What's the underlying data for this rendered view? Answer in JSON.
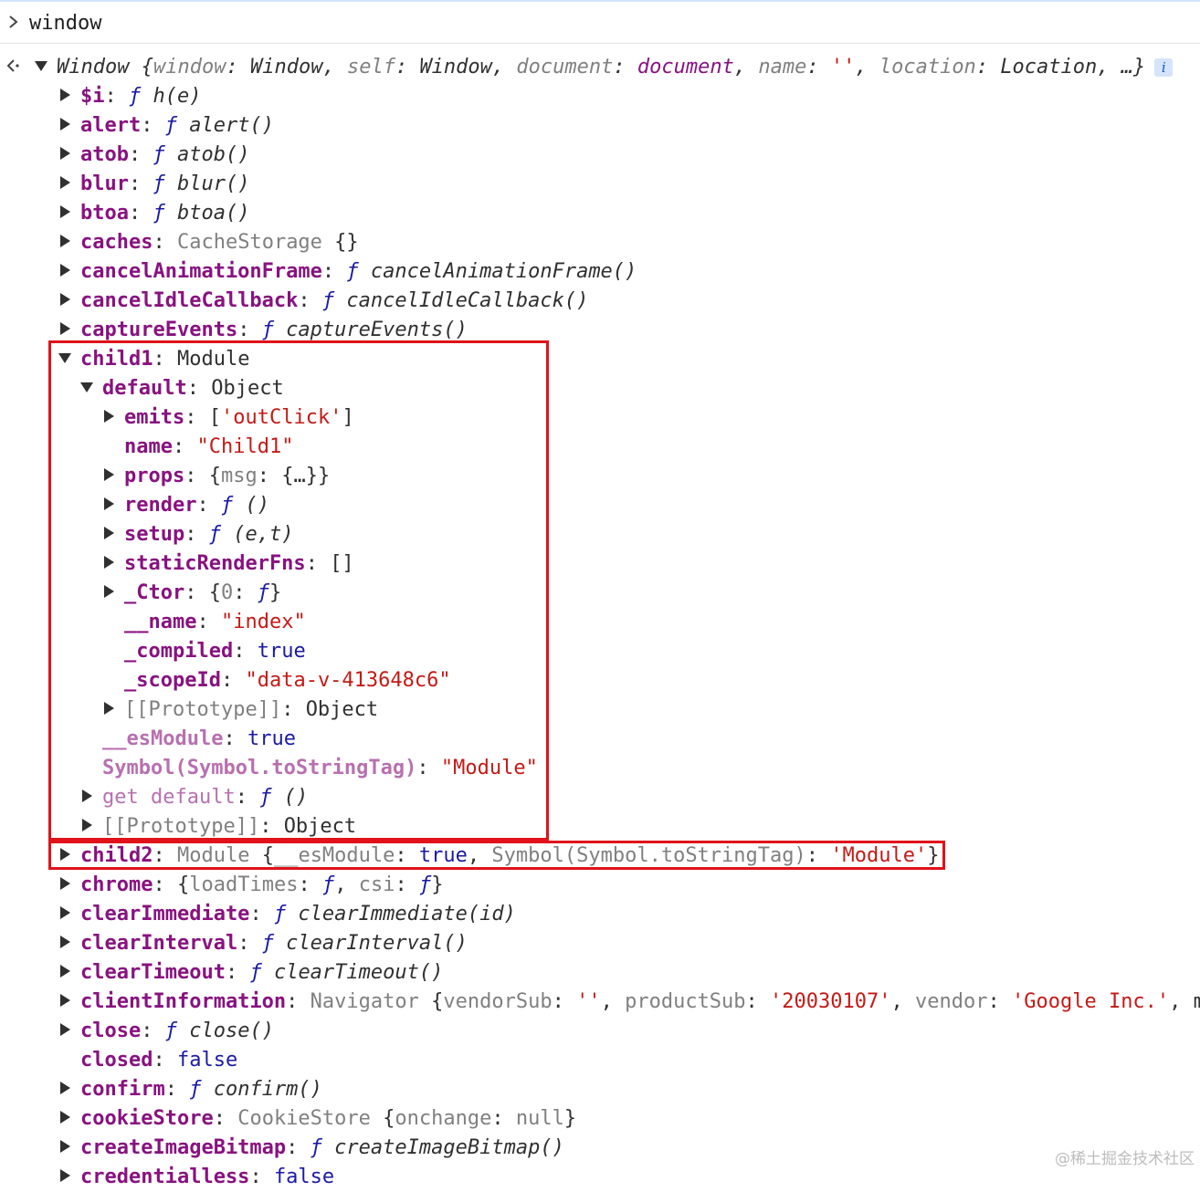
{
  "console": {
    "prompt": "window",
    "window_summary": {
      "name": "Window",
      "props": [
        {
          "key": "window",
          "value": "Window",
          "kind": "cls"
        },
        {
          "key": "self",
          "value": "Window",
          "kind": "cls"
        },
        {
          "key": "document",
          "value": "document",
          "kind": "doc"
        },
        {
          "key": "name",
          "value": "''",
          "kind": "str"
        },
        {
          "key": "location",
          "value": "Location",
          "kind": "cls"
        }
      ],
      "ellipsis": "…}",
      "info_badge": "i"
    },
    "rows": [
      {
        "indent": 0,
        "arrow": "right",
        "key": "$i",
        "tokens": [
          [
            "fkw",
            "ƒ"
          ],
          [
            "fsig",
            " h(e)"
          ]
        ]
      },
      {
        "indent": 0,
        "arrow": "right",
        "key": "alert",
        "tokens": [
          [
            "fkw",
            "ƒ"
          ],
          [
            "fsig",
            " alert()"
          ]
        ]
      },
      {
        "indent": 0,
        "arrow": "right",
        "key": "atob",
        "tokens": [
          [
            "fkw",
            "ƒ"
          ],
          [
            "fsig",
            " atob()"
          ]
        ]
      },
      {
        "indent": 0,
        "arrow": "right",
        "key": "blur",
        "tokens": [
          [
            "fkw",
            "ƒ"
          ],
          [
            "fsig",
            " blur()"
          ]
        ]
      },
      {
        "indent": 0,
        "arrow": "right",
        "key": "btoa",
        "tokens": [
          [
            "fkw",
            "ƒ"
          ],
          [
            "fsig",
            " btoa()"
          ]
        ]
      },
      {
        "indent": 0,
        "arrow": "right",
        "key": "caches",
        "tokens": [
          [
            "gray",
            "CacheStorage"
          ],
          [
            "p",
            " {}"
          ]
        ]
      },
      {
        "indent": 0,
        "arrow": "right",
        "key": "cancelAnimationFrame",
        "tokens": [
          [
            "fkw",
            "ƒ"
          ],
          [
            "fsig",
            " cancelAnimationFrame()"
          ]
        ]
      },
      {
        "indent": 0,
        "arrow": "right",
        "key": "cancelIdleCallback",
        "tokens": [
          [
            "fkw",
            "ƒ"
          ],
          [
            "fsig",
            " cancelIdleCallback()"
          ]
        ]
      },
      {
        "indent": 0,
        "arrow": "right",
        "key": "captureEvents",
        "tokens": [
          [
            "fkw",
            "ƒ"
          ],
          [
            "fsig",
            " captureEvents()"
          ]
        ]
      },
      {
        "indent": 0,
        "arrow": "down",
        "key": "child1",
        "tokens": [
          [
            "cls",
            "Module"
          ]
        ]
      },
      {
        "indent": 1,
        "arrow": "down",
        "key": "default",
        "tokens": [
          [
            "cls",
            "Object"
          ]
        ]
      },
      {
        "indent": 2,
        "arrow": "right",
        "key": "emits",
        "tokens": [
          [
            "p",
            "["
          ],
          [
            "str",
            "'outClick'"
          ],
          [
            "p",
            "]"
          ]
        ]
      },
      {
        "indent": 2,
        "arrow": "none",
        "key": "name",
        "tokens": [
          [
            "str",
            "\"Child1\""
          ]
        ]
      },
      {
        "indent": 2,
        "arrow": "right",
        "key": "props",
        "tokens": [
          [
            "p",
            "{"
          ],
          [
            "gray",
            "msg"
          ],
          [
            "p",
            ": {…}}"
          ]
        ]
      },
      {
        "indent": 2,
        "arrow": "right",
        "key": "render",
        "tokens": [
          [
            "fkw",
            "ƒ"
          ],
          [
            "fsig",
            " ()"
          ]
        ]
      },
      {
        "indent": 2,
        "arrow": "right",
        "key": "setup",
        "tokens": [
          [
            "fkw",
            "ƒ"
          ],
          [
            "fsig",
            " (e,t)"
          ]
        ]
      },
      {
        "indent": 2,
        "arrow": "right",
        "key": "staticRenderFns",
        "tokens": [
          [
            "p",
            "[]"
          ]
        ]
      },
      {
        "indent": 2,
        "arrow": "right",
        "key": "_Ctor",
        "tokens": [
          [
            "p",
            "{"
          ],
          [
            "gray",
            "0"
          ],
          [
            "p",
            ": "
          ],
          [
            "fkw",
            "ƒ"
          ],
          [
            "p",
            "}"
          ]
        ]
      },
      {
        "indent": 2,
        "arrow": "none",
        "key": "__name",
        "tokens": [
          [
            "str",
            "\"index\""
          ]
        ]
      },
      {
        "indent": 2,
        "arrow": "none",
        "key": "_compiled",
        "tokens": [
          [
            "bool",
            "true"
          ]
        ]
      },
      {
        "indent": 2,
        "arrow": "none",
        "key": "_scopeId",
        "tokens": [
          [
            "str",
            "\"data-v-413648c6\""
          ]
        ]
      },
      {
        "indent": 2,
        "arrow": "right",
        "key": "[[Prototype]]",
        "keyStyle": "proto",
        "tokens": [
          [
            "cls",
            "Object"
          ]
        ]
      },
      {
        "indent": 1,
        "arrow": "none",
        "key": "__esModule",
        "keyStyle": "dim",
        "tokens": [
          [
            "bool",
            "true"
          ]
        ]
      },
      {
        "indent": 1,
        "arrow": "none",
        "key": "Symbol(Symbol.toStringTag)",
        "keyStyle": "dim",
        "tokens": [
          [
            "str",
            "\"Module\""
          ]
        ]
      },
      {
        "indent": 1,
        "arrow": "right",
        "key": "get default",
        "keyStyle": "dimlight",
        "tokens": [
          [
            "fkw",
            "ƒ"
          ],
          [
            "fsig",
            " ()"
          ]
        ]
      },
      {
        "indent": 1,
        "arrow": "right",
        "key": "[[Prototype]]",
        "keyStyle": "proto",
        "tokens": [
          [
            "cls",
            "Object"
          ]
        ]
      },
      {
        "indent": 0,
        "arrow": "right",
        "key": "child2",
        "tokens": [
          [
            "gray",
            "Module "
          ],
          [
            "p",
            "{"
          ],
          [
            "gray",
            "__esModule"
          ],
          [
            "p",
            ": "
          ],
          [
            "bool",
            "true"
          ],
          [
            "p",
            ", "
          ],
          [
            "gray",
            "Symbol(Symbol.toStringTag)"
          ],
          [
            "p",
            ": "
          ],
          [
            "str",
            "'Module'"
          ],
          [
            "p",
            "}"
          ]
        ]
      },
      {
        "indent": 0,
        "arrow": "right",
        "key": "chrome",
        "tokens": [
          [
            "p",
            "{"
          ],
          [
            "gray",
            "loadTimes"
          ],
          [
            "p",
            ": "
          ],
          [
            "fkw",
            "ƒ"
          ],
          [
            "p",
            ", "
          ],
          [
            "gray",
            "csi"
          ],
          [
            "p",
            ": "
          ],
          [
            "fkw",
            "ƒ"
          ],
          [
            "p",
            "}"
          ]
        ]
      },
      {
        "indent": 0,
        "arrow": "right",
        "key": "clearImmediate",
        "tokens": [
          [
            "fkw",
            "ƒ"
          ],
          [
            "fsig",
            " clearImmediate(id)"
          ]
        ]
      },
      {
        "indent": 0,
        "arrow": "right",
        "key": "clearInterval",
        "tokens": [
          [
            "fkw",
            "ƒ"
          ],
          [
            "fsig",
            " clearInterval()"
          ]
        ]
      },
      {
        "indent": 0,
        "arrow": "right",
        "key": "clearTimeout",
        "tokens": [
          [
            "fkw",
            "ƒ"
          ],
          [
            "fsig",
            " clearTimeout()"
          ]
        ]
      },
      {
        "indent": 0,
        "arrow": "right",
        "key": "clientInformation",
        "tokens": [
          [
            "gray",
            "Navigator "
          ],
          [
            "p",
            "{"
          ],
          [
            "gray",
            "vendorSub"
          ],
          [
            "p",
            ": "
          ],
          [
            "str",
            "''"
          ],
          [
            "p",
            ", "
          ],
          [
            "gray",
            "productSub"
          ],
          [
            "p",
            ": "
          ],
          [
            "str",
            "'20030107'"
          ],
          [
            "p",
            ", "
          ],
          [
            "gray",
            "vendor"
          ],
          [
            "p",
            ": "
          ],
          [
            "str",
            "'Google Inc.'"
          ],
          [
            "p",
            ", m"
          ]
        ]
      },
      {
        "indent": 0,
        "arrow": "right",
        "key": "close",
        "tokens": [
          [
            "fkw",
            "ƒ"
          ],
          [
            "fsig",
            " close()"
          ]
        ]
      },
      {
        "indent": 0,
        "arrow": "none",
        "key": "closed",
        "tokens": [
          [
            "bool",
            "false"
          ]
        ]
      },
      {
        "indent": 0,
        "arrow": "right",
        "key": "confirm",
        "tokens": [
          [
            "fkw",
            "ƒ"
          ],
          [
            "fsig",
            " confirm()"
          ]
        ]
      },
      {
        "indent": 0,
        "arrow": "right",
        "key": "cookieStore",
        "tokens": [
          [
            "gray",
            "CookieStore "
          ],
          [
            "p",
            "{"
          ],
          [
            "gray",
            "onchange"
          ],
          [
            "p",
            ": "
          ],
          [
            "nul",
            "null"
          ],
          [
            "p",
            "}"
          ]
        ]
      },
      {
        "indent": 0,
        "arrow": "right",
        "key": "createImageBitmap",
        "tokens": [
          [
            "fkw",
            "ƒ"
          ],
          [
            "fsig",
            " createImageBitmap()"
          ]
        ]
      },
      {
        "indent": 0,
        "arrow": "right",
        "key": "credentialless",
        "tokens": [
          [
            "bool",
            "false"
          ]
        ]
      }
    ]
  },
  "watermark": "@稀土掘金技术社区"
}
